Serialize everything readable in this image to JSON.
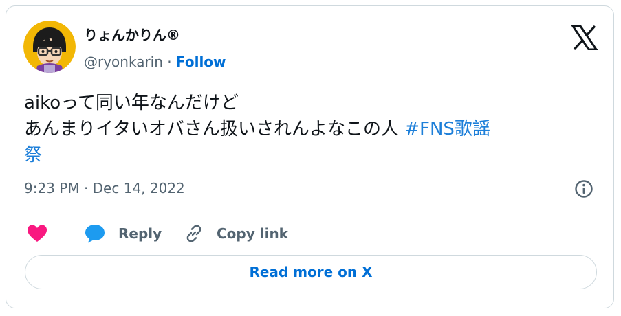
{
  "author": {
    "display_name": "りょんかりん®",
    "handle": "@ryonkarin",
    "separator": "·",
    "follow_label": "Follow"
  },
  "tweet": {
    "line1": "aikoって同い年なんだけど",
    "line2": "あんまりイタいオバさん扱いされんよなこの人 ",
    "hashtag_part1": "#FNS歌謡",
    "hashtag_part2": "祭"
  },
  "timestamp": "9:23 PM · Dec 14, 2022",
  "actions": {
    "reply_label": "Reply",
    "copy_label": "Copy link"
  },
  "read_more_label": "Read more on X",
  "icons": {
    "logo": "x-logo-icon",
    "info": "info-icon",
    "like": "heart-icon",
    "reply": "speech-bubble-icon",
    "copy": "link-icon"
  },
  "colors": {
    "link": "#006fd6",
    "hashtag": "#1d7fd9",
    "heart": "#f91880",
    "reply_bubble": "#1d9bf0",
    "muted": "#536471",
    "border": "#cfd9de"
  }
}
